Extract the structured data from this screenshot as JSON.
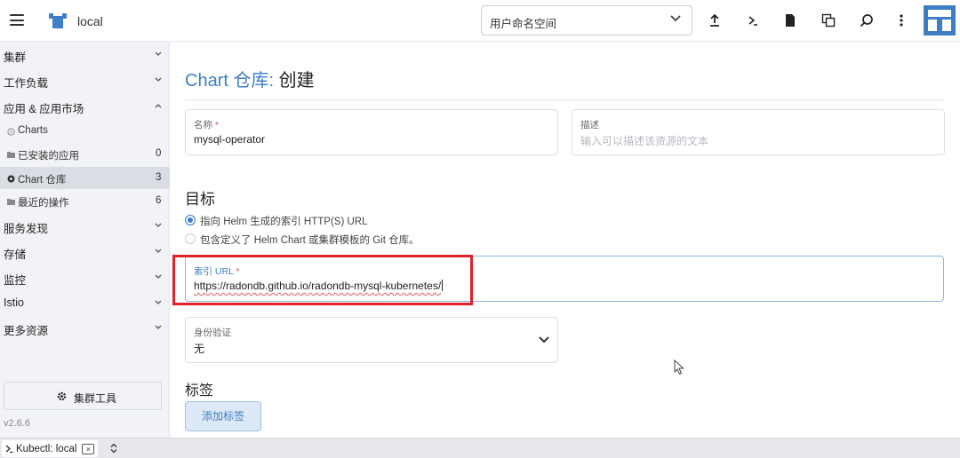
{
  "header": {
    "cluster_name": "local",
    "namespace_select": "用户命名空间",
    "icons": [
      "menu-icon",
      "cluster-logo-icon",
      "upload-icon",
      "terminal-icon",
      "file-icon",
      "copy-icon",
      "search-icon",
      "more-vertical-icon",
      "rancher-brand-icon"
    ]
  },
  "sidebar": {
    "groups": [
      {
        "label": "集群",
        "expanded": false
      },
      {
        "label": "工作负载",
        "expanded": false
      },
      {
        "label": "应用 & 应用市场",
        "expanded": true
      },
      {
        "label": "服务发现",
        "expanded": false
      },
      {
        "label": "存储",
        "expanded": false
      },
      {
        "label": "监控",
        "expanded": false
      },
      {
        "label": "Istio",
        "expanded": false
      },
      {
        "label": "更多资源",
        "expanded": false
      }
    ],
    "subitems": [
      {
        "label": "Charts",
        "count": "",
        "icon": "charts-icon"
      },
      {
        "label": "已安装的应用",
        "count": "0",
        "icon": "folder-icon"
      },
      {
        "label": "Chart 仓库",
        "count": "3",
        "icon": "repo-icon",
        "active": true
      },
      {
        "label": "最近的操作",
        "count": "6",
        "icon": "folder-icon"
      }
    ],
    "cluster_tools": "集群工具",
    "version": "v2.6.6"
  },
  "main": {
    "title_prefix": "Chart 仓库:",
    "title_action": "创建",
    "name_field": {
      "label": "名称",
      "required": "*",
      "value": "mysql-operator"
    },
    "desc_field": {
      "label": "描述",
      "placeholder": "输入可以描述该资源的文本"
    },
    "target_heading": "目标",
    "target_options": [
      {
        "label": "指向 Helm 生成的索引 HTTP(S) URL",
        "checked": true
      },
      {
        "label": "包含定义了 Helm Chart 或集群模板的 Git 仓库。",
        "checked": false
      }
    ],
    "index_url": {
      "label": "索引 URL",
      "required": "*",
      "value": "https://radondb.github.io/radondb-mysql-kubernetes/"
    },
    "auth_field": {
      "label": "身份验证",
      "value": "无"
    },
    "labels_heading": "标签",
    "add_label_button": "添加标签"
  },
  "footer": {
    "kubectl_tab": "Kubectl: local",
    "close_label": "×"
  },
  "colors": {
    "accent": "#3d7ec5",
    "highlight_box": "#e0202a",
    "sidebar_bg": "#f2f3f6"
  }
}
